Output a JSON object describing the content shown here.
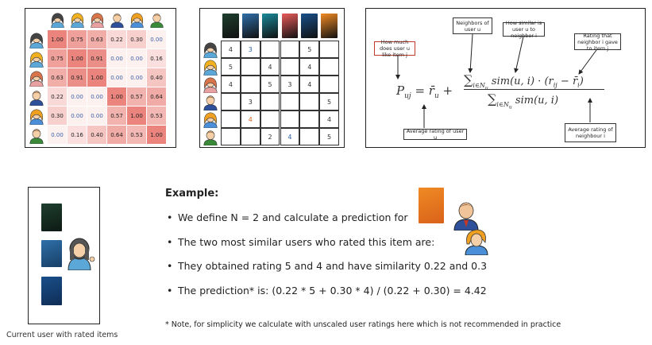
{
  "similarity_matrix": {
    "rows": [
      [
        "1.00",
        "0.75",
        "0.63",
        "0.22",
        "0.30",
        "0.00"
      ],
      [
        "0.75",
        "1.00",
        "0.91",
        "0.00",
        "0.00",
        "0.16"
      ],
      [
        "0.63",
        "0.91",
        "1.00",
        "0.00",
        "0.00",
        "0.40"
      ],
      [
        "0.22",
        "0.00",
        "0.00",
        "1.00",
        "0.57",
        "0.64"
      ],
      [
        "0.30",
        "0.00",
        "0.00",
        "0.57",
        "1.00",
        "0.53"
      ],
      [
        "0.00",
        "0.16",
        "0.40",
        "0.64",
        "0.53",
        "1.00"
      ]
    ]
  },
  "ratings_matrix": {
    "rows": [
      [
        "4",
        "3",
        "",
        "",
        "5",
        ""
      ],
      [
        "5",
        "",
        "4",
        "",
        "4",
        ""
      ],
      [
        "4",
        "",
        "5",
        "3",
        "4",
        ""
      ],
      [
        "",
        "3",
        "",
        "",
        "",
        "5"
      ],
      [
        "",
        "4",
        "",
        "",
        "",
        "4"
      ],
      [
        "",
        "",
        "2",
        "4",
        "",
        "5"
      ]
    ]
  },
  "formula": {
    "label_how_much": "How much does user u like item j",
    "label_neighbors": "Neighbors of user u",
    "label_similar": "How similar is user u to neighbor i",
    "label_rating": "Rating that neighbor i gave to item j",
    "label_avg_u": "Average rating of user u",
    "label_avg_i": "Average rating of neighbour i"
  },
  "current_user": {
    "caption": "Current user with rated items"
  },
  "example": {
    "heading": "Example:",
    "bullets": [
      "We define N = 2 and calculate a prediction for",
      "The two most similar users who rated this item are:",
      "They obtained rating 5 and 4 and have similarity 0.22 and 0.3",
      "The prediction* is: (0.22 * 5 + 0.30 * 4) / (0.22 + 0.30)  =  4.42"
    ],
    "note": "* Note, for simplicity we calculate with unscaled user ratings here which is not recommended in practice"
  }
}
